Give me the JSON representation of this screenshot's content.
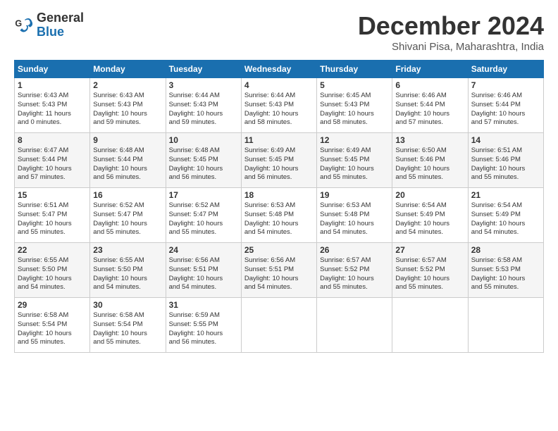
{
  "header": {
    "logo_line1": "General",
    "logo_line2": "Blue",
    "month_title": "December 2024",
    "subtitle": "Shivani Pisa, Maharashtra, India"
  },
  "weekdays": [
    "Sunday",
    "Monday",
    "Tuesday",
    "Wednesday",
    "Thursday",
    "Friday",
    "Saturday"
  ],
  "weeks": [
    [
      {
        "day": "1",
        "info": "Sunrise: 6:43 AM\nSunset: 5:43 PM\nDaylight: 11 hours\nand 0 minutes."
      },
      {
        "day": "2",
        "info": "Sunrise: 6:43 AM\nSunset: 5:43 PM\nDaylight: 10 hours\nand 59 minutes."
      },
      {
        "day": "3",
        "info": "Sunrise: 6:44 AM\nSunset: 5:43 PM\nDaylight: 10 hours\nand 59 minutes."
      },
      {
        "day": "4",
        "info": "Sunrise: 6:44 AM\nSunset: 5:43 PM\nDaylight: 10 hours\nand 58 minutes."
      },
      {
        "day": "5",
        "info": "Sunrise: 6:45 AM\nSunset: 5:43 PM\nDaylight: 10 hours\nand 58 minutes."
      },
      {
        "day": "6",
        "info": "Sunrise: 6:46 AM\nSunset: 5:44 PM\nDaylight: 10 hours\nand 57 minutes."
      },
      {
        "day": "7",
        "info": "Sunrise: 6:46 AM\nSunset: 5:44 PM\nDaylight: 10 hours\nand 57 minutes."
      }
    ],
    [
      {
        "day": "8",
        "info": "Sunrise: 6:47 AM\nSunset: 5:44 PM\nDaylight: 10 hours\nand 57 minutes."
      },
      {
        "day": "9",
        "info": "Sunrise: 6:48 AM\nSunset: 5:44 PM\nDaylight: 10 hours\nand 56 minutes."
      },
      {
        "day": "10",
        "info": "Sunrise: 6:48 AM\nSunset: 5:45 PM\nDaylight: 10 hours\nand 56 minutes."
      },
      {
        "day": "11",
        "info": "Sunrise: 6:49 AM\nSunset: 5:45 PM\nDaylight: 10 hours\nand 56 minutes."
      },
      {
        "day": "12",
        "info": "Sunrise: 6:49 AM\nSunset: 5:45 PM\nDaylight: 10 hours\nand 55 minutes."
      },
      {
        "day": "13",
        "info": "Sunrise: 6:50 AM\nSunset: 5:46 PM\nDaylight: 10 hours\nand 55 minutes."
      },
      {
        "day": "14",
        "info": "Sunrise: 6:51 AM\nSunset: 5:46 PM\nDaylight: 10 hours\nand 55 minutes."
      }
    ],
    [
      {
        "day": "15",
        "info": "Sunrise: 6:51 AM\nSunset: 5:47 PM\nDaylight: 10 hours\nand 55 minutes."
      },
      {
        "day": "16",
        "info": "Sunrise: 6:52 AM\nSunset: 5:47 PM\nDaylight: 10 hours\nand 55 minutes."
      },
      {
        "day": "17",
        "info": "Sunrise: 6:52 AM\nSunset: 5:47 PM\nDaylight: 10 hours\nand 55 minutes."
      },
      {
        "day": "18",
        "info": "Sunrise: 6:53 AM\nSunset: 5:48 PM\nDaylight: 10 hours\nand 54 minutes."
      },
      {
        "day": "19",
        "info": "Sunrise: 6:53 AM\nSunset: 5:48 PM\nDaylight: 10 hours\nand 54 minutes."
      },
      {
        "day": "20",
        "info": "Sunrise: 6:54 AM\nSunset: 5:49 PM\nDaylight: 10 hours\nand 54 minutes."
      },
      {
        "day": "21",
        "info": "Sunrise: 6:54 AM\nSunset: 5:49 PM\nDaylight: 10 hours\nand 54 minutes."
      }
    ],
    [
      {
        "day": "22",
        "info": "Sunrise: 6:55 AM\nSunset: 5:50 PM\nDaylight: 10 hours\nand 54 minutes."
      },
      {
        "day": "23",
        "info": "Sunrise: 6:55 AM\nSunset: 5:50 PM\nDaylight: 10 hours\nand 54 minutes."
      },
      {
        "day": "24",
        "info": "Sunrise: 6:56 AM\nSunset: 5:51 PM\nDaylight: 10 hours\nand 54 minutes."
      },
      {
        "day": "25",
        "info": "Sunrise: 6:56 AM\nSunset: 5:51 PM\nDaylight: 10 hours\nand 54 minutes."
      },
      {
        "day": "26",
        "info": "Sunrise: 6:57 AM\nSunset: 5:52 PM\nDaylight: 10 hours\nand 55 minutes."
      },
      {
        "day": "27",
        "info": "Sunrise: 6:57 AM\nSunset: 5:52 PM\nDaylight: 10 hours\nand 55 minutes."
      },
      {
        "day": "28",
        "info": "Sunrise: 6:58 AM\nSunset: 5:53 PM\nDaylight: 10 hours\nand 55 minutes."
      }
    ],
    [
      {
        "day": "29",
        "info": "Sunrise: 6:58 AM\nSunset: 5:54 PM\nDaylight: 10 hours\nand 55 minutes."
      },
      {
        "day": "30",
        "info": "Sunrise: 6:58 AM\nSunset: 5:54 PM\nDaylight: 10 hours\nand 55 minutes."
      },
      {
        "day": "31",
        "info": "Sunrise: 6:59 AM\nSunset: 5:55 PM\nDaylight: 10 hours\nand 56 minutes."
      },
      {
        "day": "",
        "info": ""
      },
      {
        "day": "",
        "info": ""
      },
      {
        "day": "",
        "info": ""
      },
      {
        "day": "",
        "info": ""
      }
    ]
  ]
}
